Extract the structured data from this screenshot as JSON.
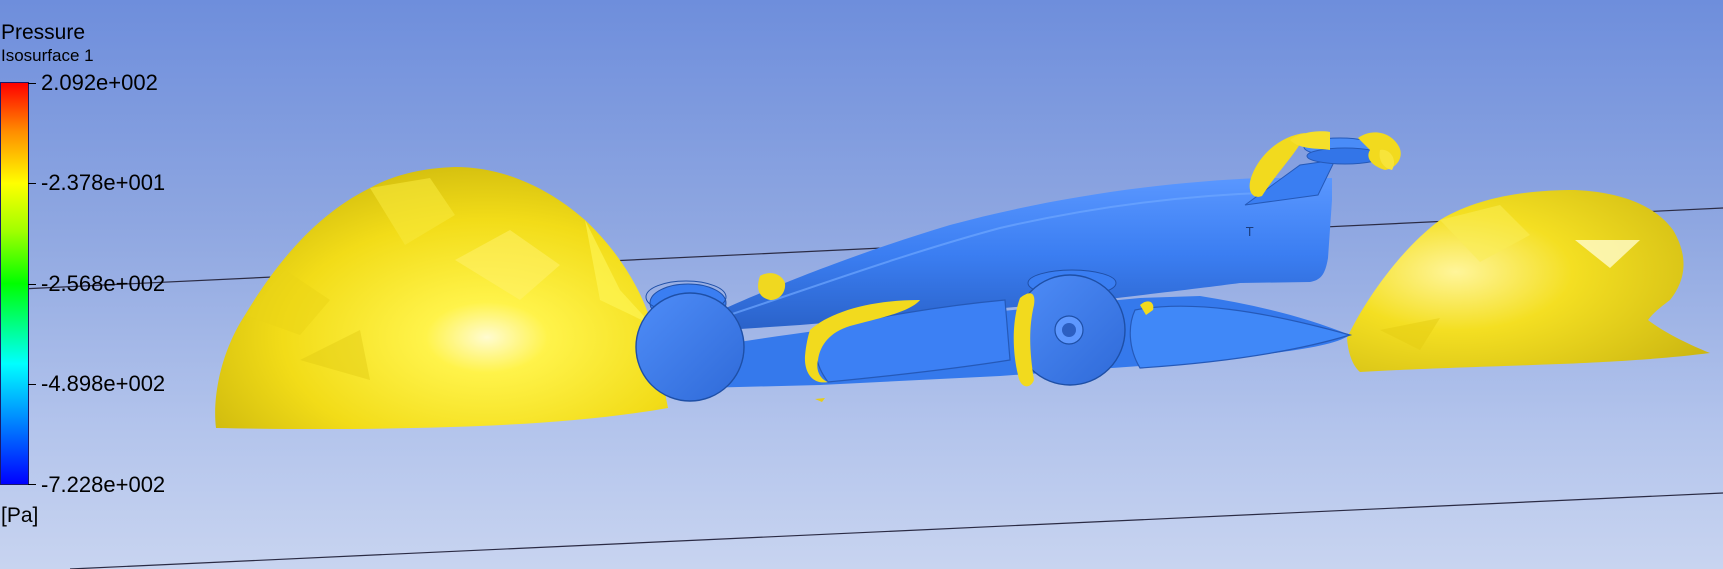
{
  "legend": {
    "title": "Pressure",
    "subtitle": "Isosurface 1",
    "ticks": [
      "2.092e+002",
      "-2.378e+001",
      "-2.568e+002",
      "-4.898e+002",
      "-7.228e+002"
    ],
    "unit": "[Pa]",
    "colormap": [
      "#ff0000",
      "#ff8c00",
      "#ffff00",
      "#a0ff00",
      "#00ff00",
      "#00ff9a",
      "#00ffff",
      "#0080ff",
      "#0000ff"
    ]
  },
  "scene": {
    "background_top": "#6e8edc",
    "background_bottom": "#c8d4f0",
    "isosurface_color": "#ffee22",
    "car_color": "#3a7ef2",
    "icons": [
      "pressure-isosurface",
      "race-car-model"
    ]
  }
}
